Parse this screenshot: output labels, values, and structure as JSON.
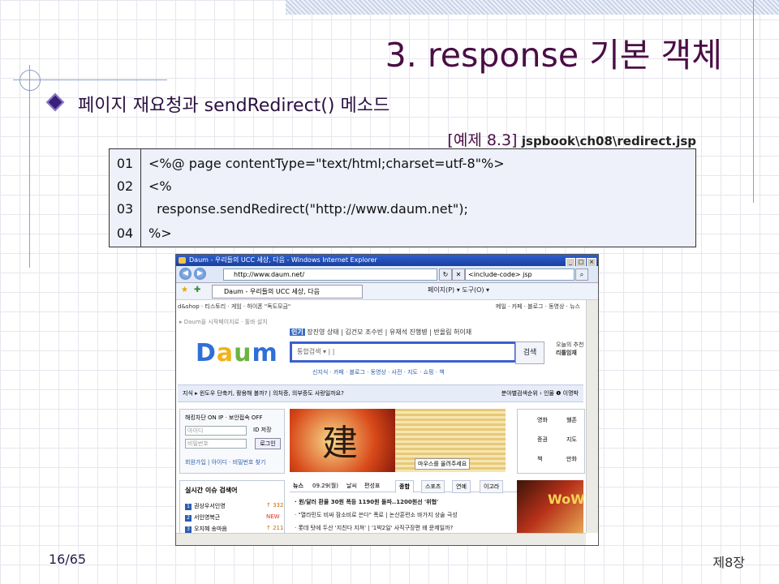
{
  "slide": {
    "title": "3. response 기본 객체",
    "bullet": "페이지 재요청과 sendRedirect() 메소드",
    "example_label": "[예제 8.3]",
    "example_path": "jspbook\\ch08\\redirect.jsp",
    "page_number": "16/65",
    "chapter": "제8장"
  },
  "code": {
    "line_numbers": [
      "01",
      "02",
      "03",
      "04"
    ],
    "lines": [
      "<%@ page contentType=\"text/html;charset=utf-8\"%>",
      "<%",
      "  response.sendRedirect(\"http://www.daum.net\");",
      "%>"
    ]
  },
  "browser": {
    "window_title": "Daum - 우리들의 UCC 세상, 다음 - Windows Internet Explorer",
    "url": "http://www.daum.net/",
    "search_text": "<include-code> jsp",
    "tab_label": "Daum - 우리들의 UCC 세상, 다음",
    "command_bar": "페이지(P) ▾   도구(O) ▾",
    "win_buttons": [
      "_",
      "□",
      "×"
    ],
    "page": {
      "top_left": "d&shop · 티스토리 · 게임 · 하이폰 \"독도모금\"",
      "top_right": "메일 · 카페 · 블로그 · 동영상 · 뉴스",
      "start_page": "▸ Daum을 시작페이지로 · 툴바 설치",
      "logo_letters": [
        "D",
        "a",
        "u",
        "m"
      ],
      "keyword_prefix": "인기",
      "keywords": "장진영 상태 | 김건모 조수빈 | 유재석 진행병 | 반올림 허이재",
      "search_placeholder": "통합검색 ▾ | |",
      "search_button": "검색",
      "categories": "신지식 · 카페 · 블로그 · 동영상 · 사전 · 지도 · 쇼핑 · 책",
      "right_promo_1": "오늘의 추천",
      "right_promo_2": "리틀임재",
      "notice_left": "지식 ▸ 윈도우 단축키, 활용해 볼까? | 의처증, 의부증도 사랑일까요?",
      "notice_right": "분야별검색순위 › 인물 ❶ 이명박",
      "login": {
        "header": "해킹차단  ON  IP · 보안접속  OFF",
        "id_placeholder": "아이디",
        "pw_placeholder": "비밀번호",
        "save_id": "ID 저장",
        "login_button": "로그인",
        "links": "회원가입 | 아이디 · 비밀번호 찾기"
      },
      "hero_char": "建",
      "hero_caption": "마우스를 올려주세요",
      "side_menu": [
        "영화",
        "웰존",
        "증권",
        "지도",
        "책",
        "만화"
      ],
      "issues_title": "실시간 이슈 검색어",
      "issues": [
        {
          "rank": "1",
          "text": "권상우서인영",
          "value": "↑ 332"
        },
        {
          "rank": "2",
          "text": "서인영복근",
          "value": "NEW"
        },
        {
          "rank": "3",
          "text": "오지혜 송마음",
          "value": "↑ 211"
        }
      ],
      "news_tabs": [
        "뉴스",
        "09.29(월)",
        "날씨",
        "편성표",
        "종합",
        "스포츠",
        "연예",
        "이고라"
      ],
      "news_items": [
        "· 원/달러 환율 30원 폭등 1190원 돌파..1200원선 '위협'",
        "· \"열라민도 비싸 잠소비로 쓴다\" 폭로 | 논산훈련소 바가지 상술 극성",
        "· 롯데 탓에 두산 '지친다 지쳐' | '1박2일' 사직구장편 왜 문제일까?"
      ],
      "ad_text": "WoW"
    }
  }
}
